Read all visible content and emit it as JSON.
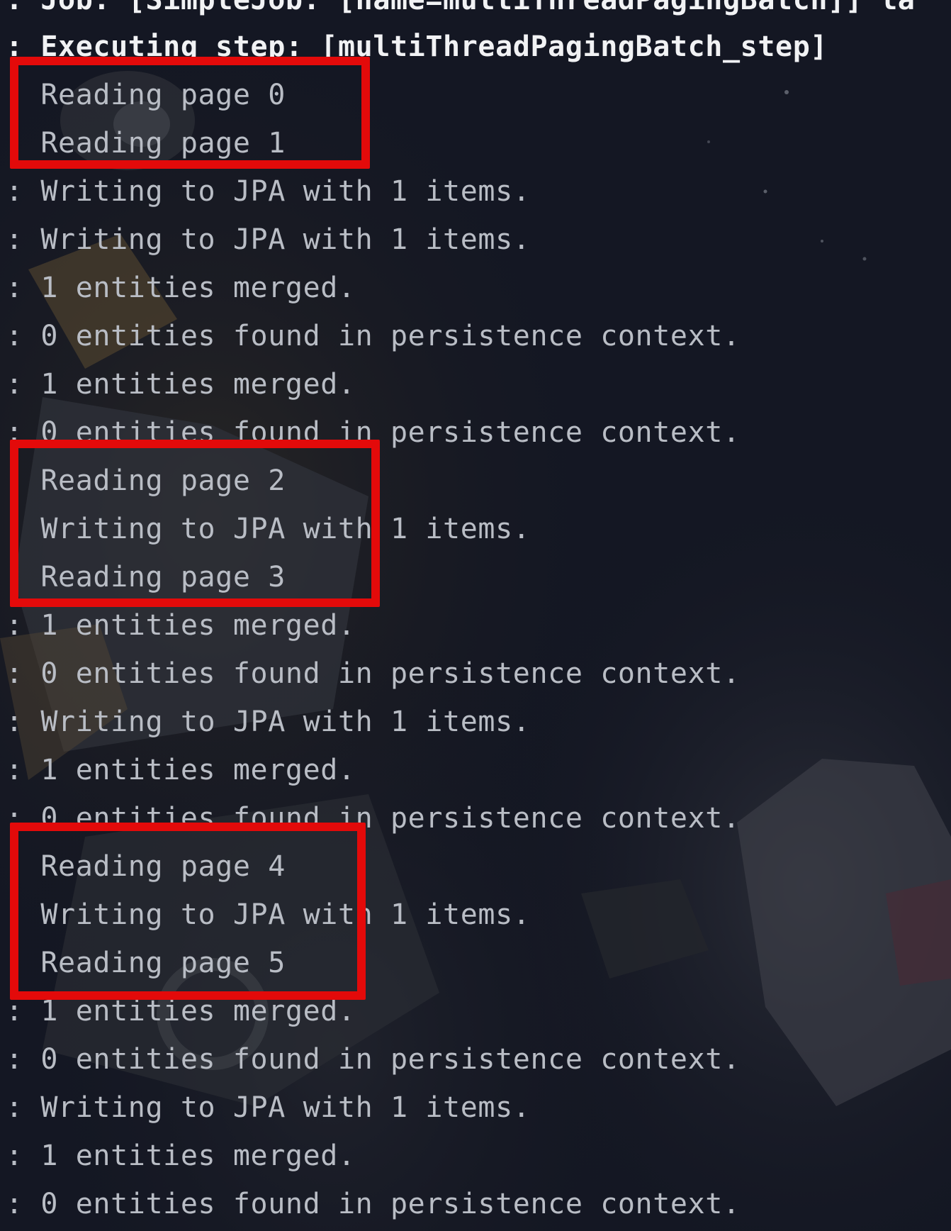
{
  "console": {
    "lines": [
      {
        "text": ": Job: [SimpleJob: [name=multiThreadPagingBatch]] la",
        "kind": "header"
      },
      {
        "text": ": Executing step: [multiThreadPagingBatch_step]",
        "kind": "header"
      },
      {
        "text": "  Reading page 0",
        "kind": "log"
      },
      {
        "text": "  Reading page 1",
        "kind": "log"
      },
      {
        "text": ": Writing to JPA with 1 items.",
        "kind": "log"
      },
      {
        "text": ": Writing to JPA with 1 items.",
        "kind": "log"
      },
      {
        "text": ": 1 entities merged.",
        "kind": "log"
      },
      {
        "text": ": 0 entities found in persistence context.",
        "kind": "log"
      },
      {
        "text": ": 1 entities merged.",
        "kind": "log"
      },
      {
        "text": ": 0 entities found in persistence context.",
        "kind": "log"
      },
      {
        "text": "  Reading page 2",
        "kind": "log"
      },
      {
        "text": "  Writing to JPA with 1 items.",
        "kind": "log"
      },
      {
        "text": "  Reading page 3",
        "kind": "log"
      },
      {
        "text": ": 1 entities merged.",
        "kind": "log"
      },
      {
        "text": ": 0 entities found in persistence context.",
        "kind": "log"
      },
      {
        "text": ": Writing to JPA with 1 items.",
        "kind": "log"
      },
      {
        "text": ": 1 entities merged.",
        "kind": "log"
      },
      {
        "text": ": 0 entities found in persistence context.",
        "kind": "log"
      },
      {
        "text": "  Reading page 4",
        "kind": "log"
      },
      {
        "text": "  Writing to JPA with 1 items.",
        "kind": "log"
      },
      {
        "text": "  Reading page 5",
        "kind": "log"
      },
      {
        "text": ": 1 entities merged.",
        "kind": "log"
      },
      {
        "text": ": 0 entities found in persistence context.",
        "kind": "log"
      },
      {
        "text": ": Writing to JPA with 1 items.",
        "kind": "log"
      },
      {
        "text": ": 1 entities merged.",
        "kind": "log"
      },
      {
        "text": ": 0 entities found in persistence context.",
        "kind": "log"
      }
    ]
  },
  "highlights": [
    {
      "label": "reading-pages-0-1",
      "first_line": 2,
      "last_line": 3
    },
    {
      "label": "reading-pages-2-3",
      "first_line": 10,
      "last_line": 12
    },
    {
      "label": "reading-pages-4-5",
      "first_line": 18,
      "last_line": 20
    }
  ],
  "colors": {
    "background": "#12151f",
    "header_text": "#f1f2f4",
    "log_text": "#b9bdc5",
    "highlight_border": "#e30a0a"
  }
}
